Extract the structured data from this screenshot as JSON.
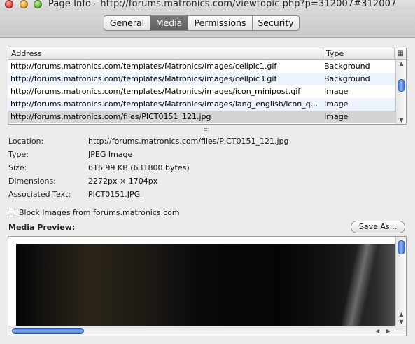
{
  "window": {
    "title": "Page Info - http://forums.matronics.com/viewtopic.php?p=312007#312007"
  },
  "tabs": [
    {
      "label": "General",
      "selected": false
    },
    {
      "label": "Media",
      "selected": true
    },
    {
      "label": "Permissions",
      "selected": false
    },
    {
      "label": "Security",
      "selected": false
    }
  ],
  "media_table": {
    "columns": {
      "address": "Address",
      "type": "Type"
    },
    "rows": [
      {
        "address": "http://forums.matronics.com/templates/Matronics/images/cellpic1.gif",
        "type": "Background",
        "selected": false
      },
      {
        "address": "http://forums.matronics.com/templates/Matronics/images/cellpic3.gif",
        "type": "Background",
        "selected": false
      },
      {
        "address": "http://forums.matronics.com/templates/Matronics/images/icon_minipost.gif",
        "type": "Image",
        "selected": false
      },
      {
        "address": "http://forums.matronics.com/templates/Matronics/images/lang_english/icon_q...",
        "type": "Image",
        "selected": false
      },
      {
        "address": "http://forums.matronics.com/files/PICT0151_121.jpg",
        "type": "Image",
        "selected": true
      }
    ]
  },
  "details": {
    "location_label": "Location:",
    "location": "http://forums.matronics.com/files/PICT0151_121.jpg",
    "type_label": "Type:",
    "type": "JPEG Image",
    "size_label": "Size:",
    "size": "616.99 KB (631800 bytes)",
    "dimensions_label": "Dimensions:",
    "dimensions": "2272px × 1704px",
    "associated_text_label": "Associated Text:",
    "associated_text": "PICT0151.JPG"
  },
  "block_images": {
    "label": "Block Images from forums.matronics.com",
    "checked": false
  },
  "preview": {
    "label": "Media Preview:",
    "save_as": "Save As..."
  },
  "colors": {
    "selected_tab": "#666666",
    "scroll_thumb": "#5b86d6",
    "row_alt": "#edf3fe"
  }
}
